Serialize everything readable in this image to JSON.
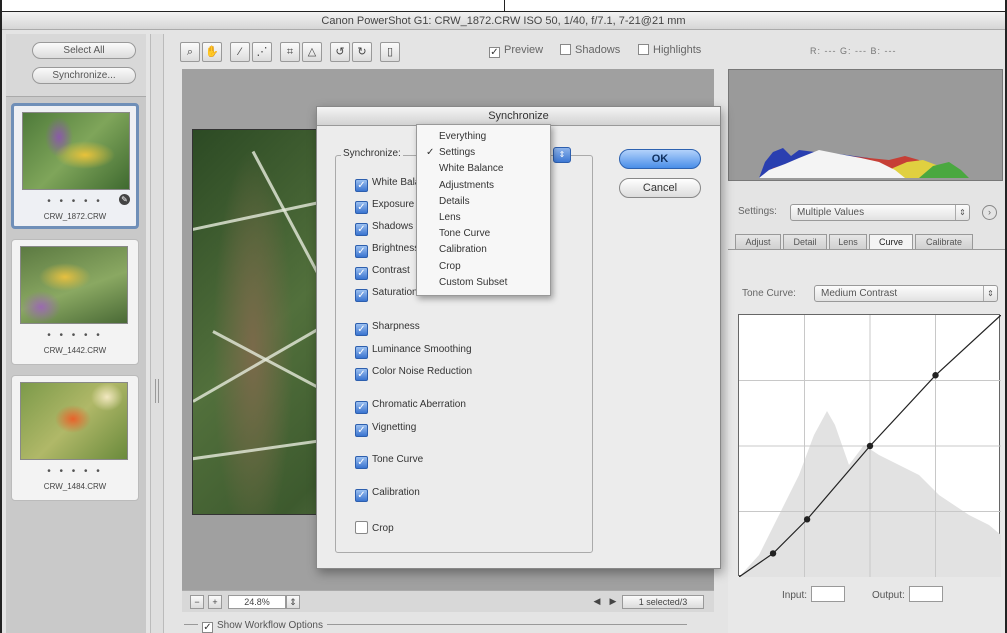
{
  "window_title": "Canon PowerShot G1:  CRW_1872.CRW  ISO 50, 1/40, f/7.1, 7-21@21 mm",
  "filmstrip": {
    "select_all_label": "Select All",
    "synchronize_label": "Synchronize...",
    "thumbnails": [
      {
        "caption": "CRW_1872.CRW",
        "dots": "• • • • •"
      },
      {
        "caption": "CRW_1442.CRW",
        "dots": "• • • • •"
      },
      {
        "caption": "CRW_1484.CRW",
        "dots": "• • • • •"
      }
    ]
  },
  "toolbar": {
    "tool_icons": [
      "zoom-icon",
      "hand-icon",
      "eyedropper-icon",
      "color-sampler-icon",
      "crop-icon",
      "straighten-icon",
      "rotate-left-icon",
      "rotate-right-icon",
      "trash-icon"
    ],
    "preview_label": "Preview",
    "shadows_label": "Shadows",
    "highlights_label": "Highlights",
    "rgb_readout": "R: ---  G: ---  B: ---"
  },
  "zoom": {
    "value": "24.8%",
    "selected_text": "1 selected/3"
  },
  "workflow_label": "Show Workflow Options",
  "settings": {
    "label": "Settings:",
    "value": "Multiple Values"
  },
  "tabs": [
    "Adjust",
    "Detail",
    "Lens",
    "Curve",
    "Calibrate"
  ],
  "active_tab": "Curve",
  "tone_curve": {
    "label": "Tone Curve:",
    "value": "Medium Contrast",
    "input_label": "Input:",
    "output_label": "Output:",
    "points": [
      [
        0,
        0
      ],
      [
        0.13,
        0.09
      ],
      [
        0.26,
        0.22
      ],
      [
        0.5,
        0.5
      ],
      [
        0.75,
        0.77
      ],
      [
        1,
        1
      ]
    ]
  },
  "dialog": {
    "title": "Synchronize",
    "synchronize_label": "Synchronize:",
    "ok_label": "OK",
    "cancel_label": "Cancel",
    "checkboxes": [
      {
        "label": "White Balance",
        "checked": true
      },
      {
        "label": "Exposure",
        "checked": true
      },
      {
        "label": "Shadows",
        "checked": true
      },
      {
        "label": "Brightness",
        "checked": true
      },
      {
        "label": "Contrast",
        "checked": true
      },
      {
        "label": "Saturation",
        "checked": true
      },
      {
        "label": "Sharpness",
        "checked": true
      },
      {
        "label": "Luminance Smoothing",
        "checked": true
      },
      {
        "label": "Color Noise Reduction",
        "checked": true
      },
      {
        "label": "Chromatic Aberration",
        "checked": true
      },
      {
        "label": "Vignetting",
        "checked": true
      },
      {
        "label": "Tone Curve",
        "checked": true
      },
      {
        "label": "Calibration",
        "checked": true
      },
      {
        "label": "Crop",
        "checked": false
      }
    ],
    "menu": {
      "items": [
        "Everything",
        "Settings",
        "White Balance",
        "Adjustments",
        "Details",
        "Lens",
        "Tone Curve",
        "Calibration",
        "Crop",
        "Custom Subset"
      ],
      "selected": "Settings"
    }
  },
  "colors": {
    "accent_blue": "#3d78d4",
    "selection_border": "#6f8fb8",
    "histogram_bg": "#9a9a9a"
  }
}
